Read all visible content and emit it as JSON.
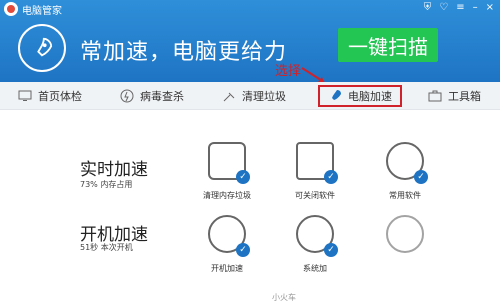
{
  "app": {
    "title": "电脑管家"
  },
  "hero": {
    "slogan": "常加速，电脑更给力",
    "cta": "一键扫描"
  },
  "annotation": {
    "select": "选择"
  },
  "tabs": [
    {
      "label": "首页体检",
      "icon": "monitor-icon"
    },
    {
      "label": "病毒查杀",
      "icon": "shield-icon"
    },
    {
      "label": "清理垃圾",
      "icon": "broom-icon"
    },
    {
      "label": "电脑加速",
      "icon": "rocket-icon",
      "active": true
    },
    {
      "label": "工具箱",
      "icon": "toolbox-icon"
    }
  ],
  "sections": {
    "realtime": {
      "title": "实时加速",
      "subtitle": "73% 内存占用"
    },
    "startup": {
      "title": "开机加速",
      "subtitle": "51秒 本次开机"
    }
  },
  "tools": {
    "realtime": [
      {
        "label": "清理内存垃圾",
        "icon": "memory-chip-icon"
      },
      {
        "label": "可关闭软件",
        "icon": "box-icon"
      },
      {
        "label": "常用软件",
        "icon": "disc-icon"
      }
    ],
    "startup": [
      {
        "label": "开机加速",
        "icon": "power-icon"
      },
      {
        "label": "系统加",
        "icon": "gear-icon"
      },
      {
        "label": "",
        "icon": "globe-icon"
      }
    ]
  },
  "footer": {
    "brand": "小火车"
  }
}
